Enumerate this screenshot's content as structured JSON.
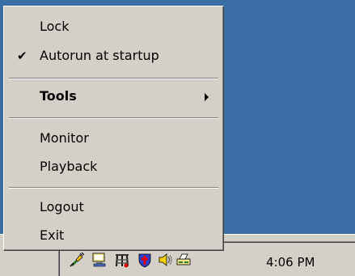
{
  "menu": {
    "items": [
      {
        "label": "Lock",
        "checked": false
      },
      {
        "label": "Autorun at startup",
        "checked": true,
        "check_glyph": "✔"
      },
      {
        "label": "Tools",
        "bold": true,
        "has_submenu": true
      },
      {
        "label": "Monitor"
      },
      {
        "label": "Playback"
      },
      {
        "label": "Logout"
      },
      {
        "label": "Exit"
      }
    ]
  },
  "taskbar": {
    "clock": "4:06 PM",
    "tray_icons": [
      "power-plug-icon",
      "monitor-icon",
      "network-icon",
      "shield-icon",
      "speaker-icon",
      "scanner-icon"
    ]
  },
  "colors": {
    "desktop": "#3a6ea5",
    "menu_face": "#d4d0c8"
  }
}
